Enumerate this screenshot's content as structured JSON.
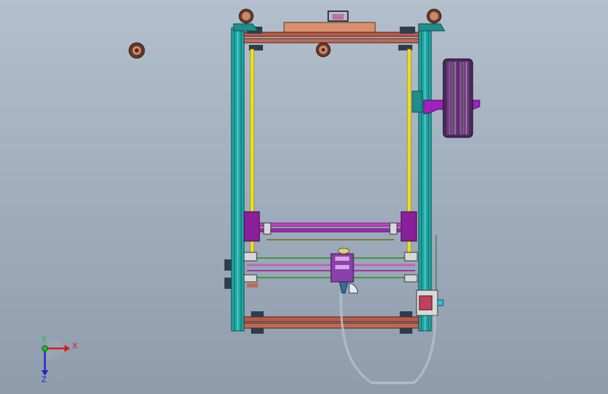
{
  "viewport": {
    "background_top": "#b3bfcc",
    "background_bottom": "#8e9cac"
  },
  "triad": {
    "x_label": "X",
    "y_label": "Y",
    "z_label": "Z",
    "x_color": "#e01919",
    "y_color": "#19c21f",
    "z_color": "#2323c8"
  },
  "model": {
    "frame_color": "#22b5b0",
    "rail_color": "#c06a55",
    "rod_color": "#f0e020",
    "carriage_color": "#8a1f9a",
    "spool_color": "#5a2a6a",
    "icons": [
      "spool-icon",
      "bearing-icon",
      "hotend-icon"
    ]
  }
}
